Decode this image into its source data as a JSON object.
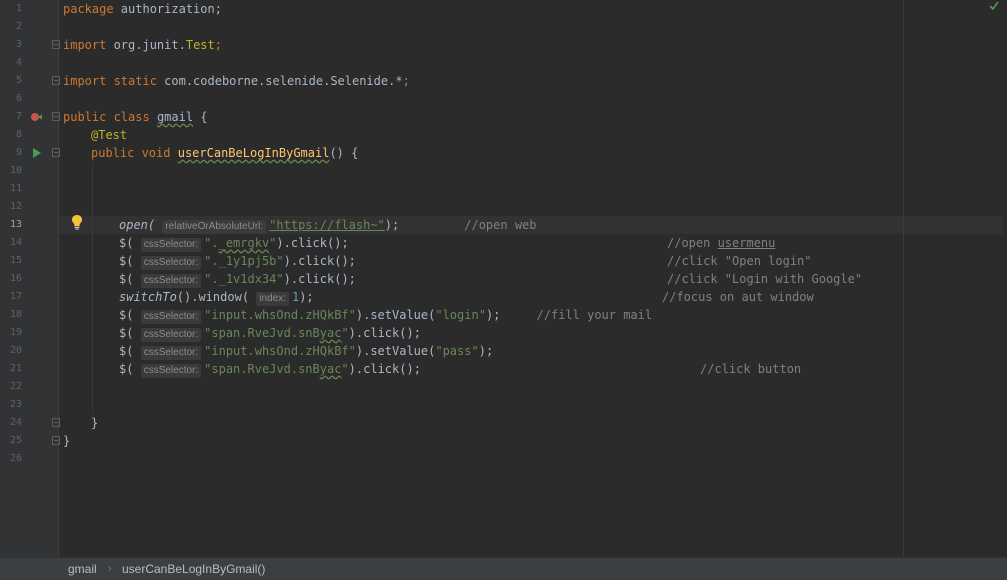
{
  "editor": {
    "line_numbers": [
      "1",
      "2",
      "3",
      "4",
      "5",
      "6",
      "7",
      "8",
      "9",
      "10",
      "11",
      "12",
      "13",
      "14",
      "15",
      "16",
      "17",
      "18",
      "19",
      "20",
      "21",
      "22",
      "23",
      "24",
      "25",
      "26"
    ],
    "current_line": "13",
    "code": {
      "l1": {
        "kw": "package",
        "rest": " authorization;"
      },
      "l3": {
        "kw": "import",
        "pkg": " org.junit.",
        "cls": "Test",
        "semi": ";"
      },
      "l5": {
        "kw": "import static",
        "rest": " com.codeborne.selenide.Selenide.*",
        "semi": ";"
      },
      "l7": {
        "kw": "public class",
        "name": "gmail",
        "brace": " {"
      },
      "l8": {
        "ann": "@Test"
      },
      "l9": {
        "kw": "public void",
        "method": "userCanBeLogInByGmail",
        "rest": "() {"
      },
      "l13": {
        "fn": "open(",
        "hint": "relativeOrAbsoluteUrl:",
        "str": "\"https://flash~\"",
        "end": ");",
        "cmt": "//open web"
      },
      "l14": {
        "call": "$(",
        "hint": "cssSelector:",
        "str_a": "\".",
        "str_b": "_emrgkv",
        "str_c": "\"",
        "end": ").click();",
        "cmt_a": "//open ",
        "cmt_b": "usermenu"
      },
      "l15": {
        "call": "$(",
        "hint": "cssSelector:",
        "str": "\"._1y1pj5b\"",
        "end": ").click();",
        "cmt": "//click \"Open login\""
      },
      "l16": {
        "call": "$(",
        "hint": "cssSelector:",
        "str": "\"._1v1dx34\"",
        "end": ").click();",
        "cmt": "//click \"Login with Google\""
      },
      "l17": {
        "fn": "switchTo",
        "mid": "().window(",
        "hint": "index:",
        "num": "1",
        "end": ");",
        "cmt": "//focus on aut window"
      },
      "l18": {
        "call": "$(",
        "hint": "cssSelector:",
        "str": "\"input.whsOnd.zHQkBf\"",
        "mid": ").setValue(",
        "str2": "\"login\"",
        "end": ");",
        "cmt": "//fill your mail"
      },
      "l19": {
        "call": "$(",
        "hint": "cssSelector:",
        "str_a": "\"span.RveJvd.snB",
        "str_b": "yac",
        "str_c": "\"",
        "end": ").click();"
      },
      "l20": {
        "call": "$(",
        "hint": "cssSelector:",
        "str": "\"input.whsOnd.zHQkBf\"",
        "mid": ").setValue(",
        "str2": "\"pass\"",
        "end": ");"
      },
      "l21": {
        "call": "$(",
        "hint": "cssSelector:",
        "str_a": "\"span.RveJvd.snB",
        "str_b": "yac",
        "str_c": "\"",
        "end": ").click();",
        "cmt": "//click button"
      },
      "l24": {
        "rest": "}"
      },
      "l25": {
        "rest": "}"
      }
    }
  },
  "breadcrumb": {
    "items": [
      "gmail",
      "userCanBeLogInByGmail()"
    ],
    "separator": "›"
  },
  "icons": {
    "run_test_class": "run-debug-icon",
    "run_method": "run-icon",
    "intention": "lightbulb-icon",
    "inspection": "check-icon",
    "fold": "fold-icon"
  },
  "colors": {
    "background": "#2b2b2b",
    "keyword": "#cc7832",
    "string": "#6a8759",
    "method": "#ffc66d",
    "annotation": "#bbb529",
    "comment": "#808080",
    "number": "#6897bb"
  }
}
